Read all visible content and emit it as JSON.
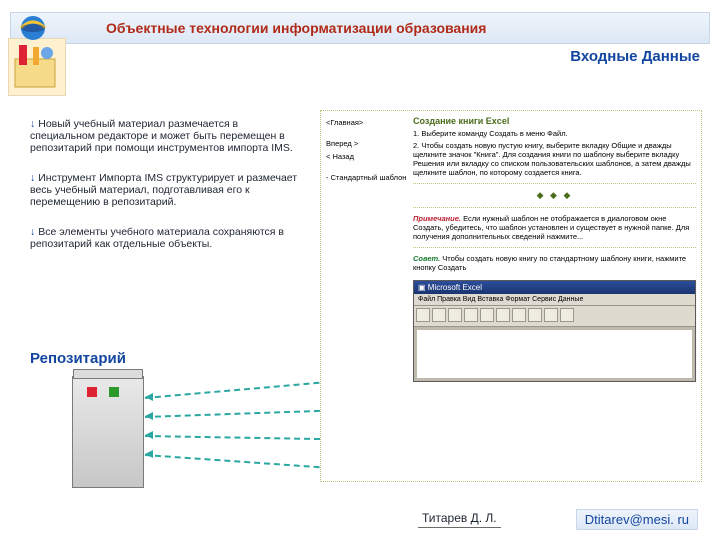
{
  "header": {
    "title": "Объектные технологии информатизации образования",
    "subtitle": "Входные Данные"
  },
  "points": {
    "p1": "Новый учебный материал размечается в специальном редакторе и может быть перемещен в репозитарий при помощи инструментов импорта IMS.",
    "p2": "Инструмент Импорта IMS структурирует и размечает весь учебный материал, подготавливая его к перемещению в репозитарий.",
    "p3": "Все элементы учебного материала сохраняются в репозитарий как отдельные объекты."
  },
  "repo_label": "Репозитарий",
  "nav": {
    "home": "<Главная>",
    "fwd": "Вперед >",
    "back": "< Назад",
    "std": "- Стандартный шаблон"
  },
  "content": {
    "heading": "Создание книги Excel",
    "step1": "1. Выберите команду Создать в меню Файл.",
    "step2": "2. Чтобы создать новую пустую книгу, выберите вкладку Общие и дважды щелкните значок \"Книга\". Для создания книги по шаблону выберите вкладку Решения или вкладку со списком пользовательских шаблонов, а затем дважды щелкните шаблон, по которому создается книга.",
    "dots": "◆ ◆ ◆",
    "note_label": "Примечание.",
    "note_text": "Если нужный шаблон не отображается в диалоговом окне Создать, убедитесь, что шаблон установлен и существует в нужной папке. Для получения дополнительных сведений нажмите...",
    "hint_label": "Совет.",
    "hint_text": "Чтобы создать новую книгу по стандартному шаблону книги, нажмите кнопку Создать",
    "excel_title": "Microsoft Excel",
    "excel_menu": "Файл  Правка  Вид  Вставка  Формат  Сервис  Данные"
  },
  "footer": {
    "name": "Титарев Д. Л.",
    "email": "Dtitarev@mesi. ru"
  },
  "chart_data": {
    "type": "table",
    "note": "slide diagram, no quantitative chart"
  }
}
